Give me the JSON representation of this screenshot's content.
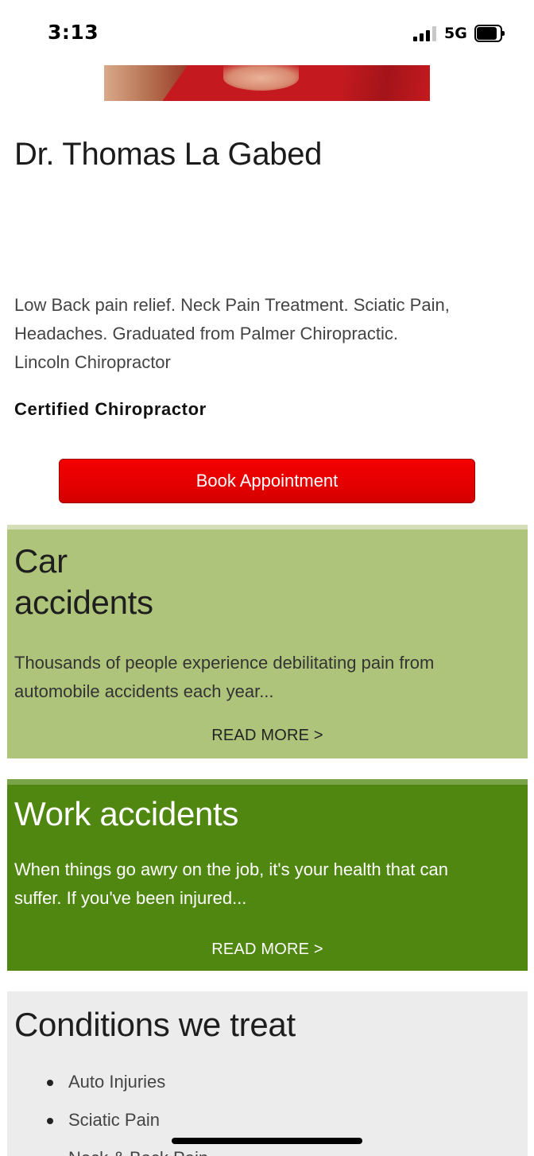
{
  "status_bar": {
    "time": "3:13",
    "network": "5G",
    "signal_bars_active": 3,
    "signal_bars_total": 4,
    "battery_level": 0.85
  },
  "doctor": {
    "name": "Dr. Thomas La Gabed",
    "description_lines": [
      "Low Back pain relief.  Neck Pain Treatment. Sciatic Pain,",
      "Headaches. Graduated from Palmer Chiropractic.",
      "Lincoln Chiropractor"
    ],
    "certification": "Certified Chiropractor"
  },
  "book_button": {
    "label": "Book Appointment",
    "color": "#e60000"
  },
  "cards": [
    {
      "title_lines": [
        "Car",
        "accidents"
      ],
      "text_lines": [
        "Thousands of people experience debilitating pain from",
        "automobile accidents each year..."
      ],
      "read_more": "READ MORE >",
      "color": "#afc47b"
    },
    {
      "title_lines": [
        "Work accidents"
      ],
      "text_lines": [
        "When things go awry on the job, it's your health that can",
        "suffer.  If you've been injured..."
      ],
      "read_more": "READ MORE >",
      "color": "#508711"
    }
  ],
  "conditions": {
    "title": "Conditions we treat",
    "items": [
      "Auto Injuries",
      "Sciatic Pain",
      "Neck & Back Pain"
    ]
  }
}
